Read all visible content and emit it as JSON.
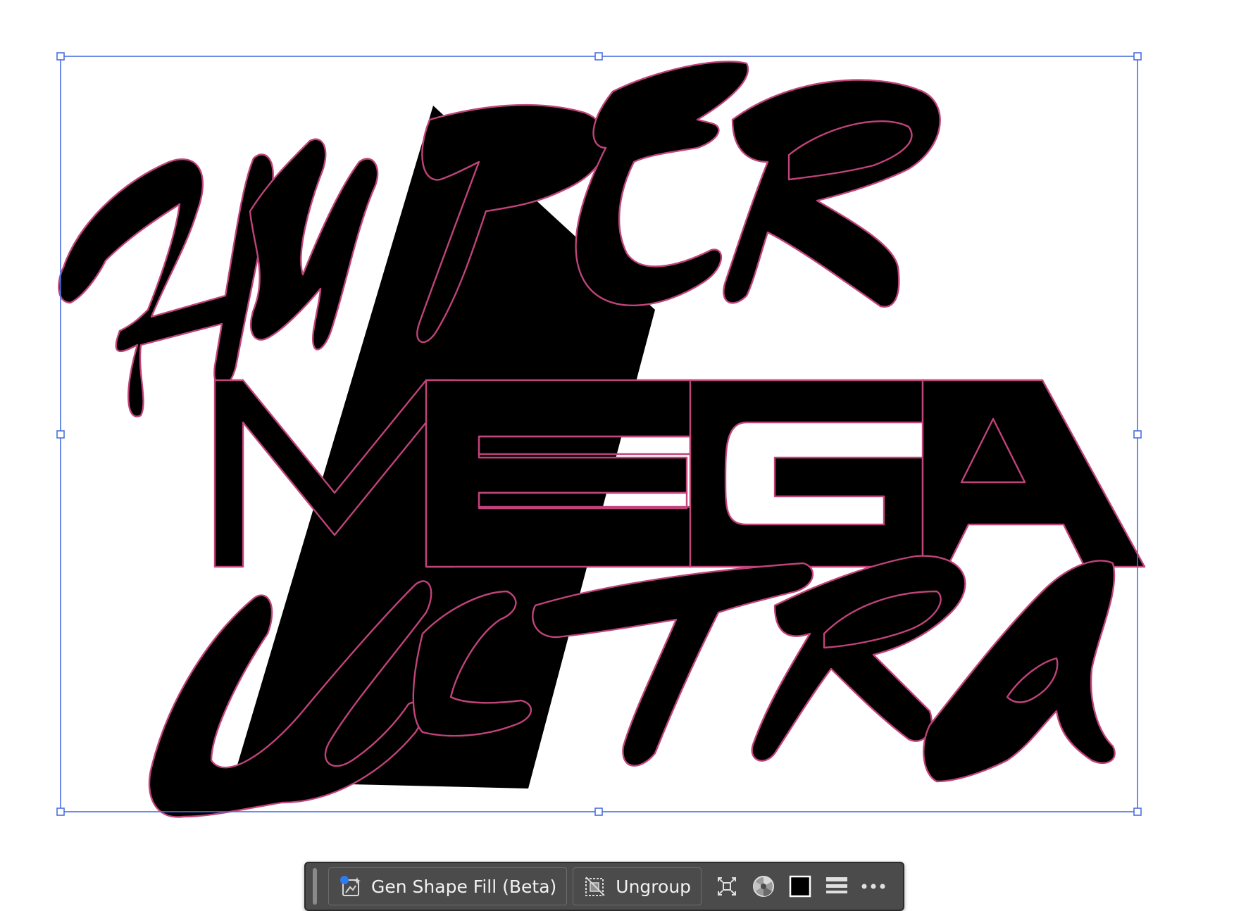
{
  "artwork": {
    "words": [
      "HYPER",
      "MEGA",
      "ULTRA"
    ],
    "fill_color": "#000000",
    "outline_color": "#c0437a",
    "selection_color": "#4a6fe0"
  },
  "taskbar": {
    "gen_shape_fill_label": "Gen Shape Fill (Beta)",
    "ungroup_label": "Ungroup",
    "icons": [
      "gen-shape-fill-icon",
      "ungroup-icon",
      "isolate-icon",
      "recolor-icon",
      "fill-swatch-icon",
      "stroke-weight-icon",
      "more-options-icon"
    ]
  }
}
